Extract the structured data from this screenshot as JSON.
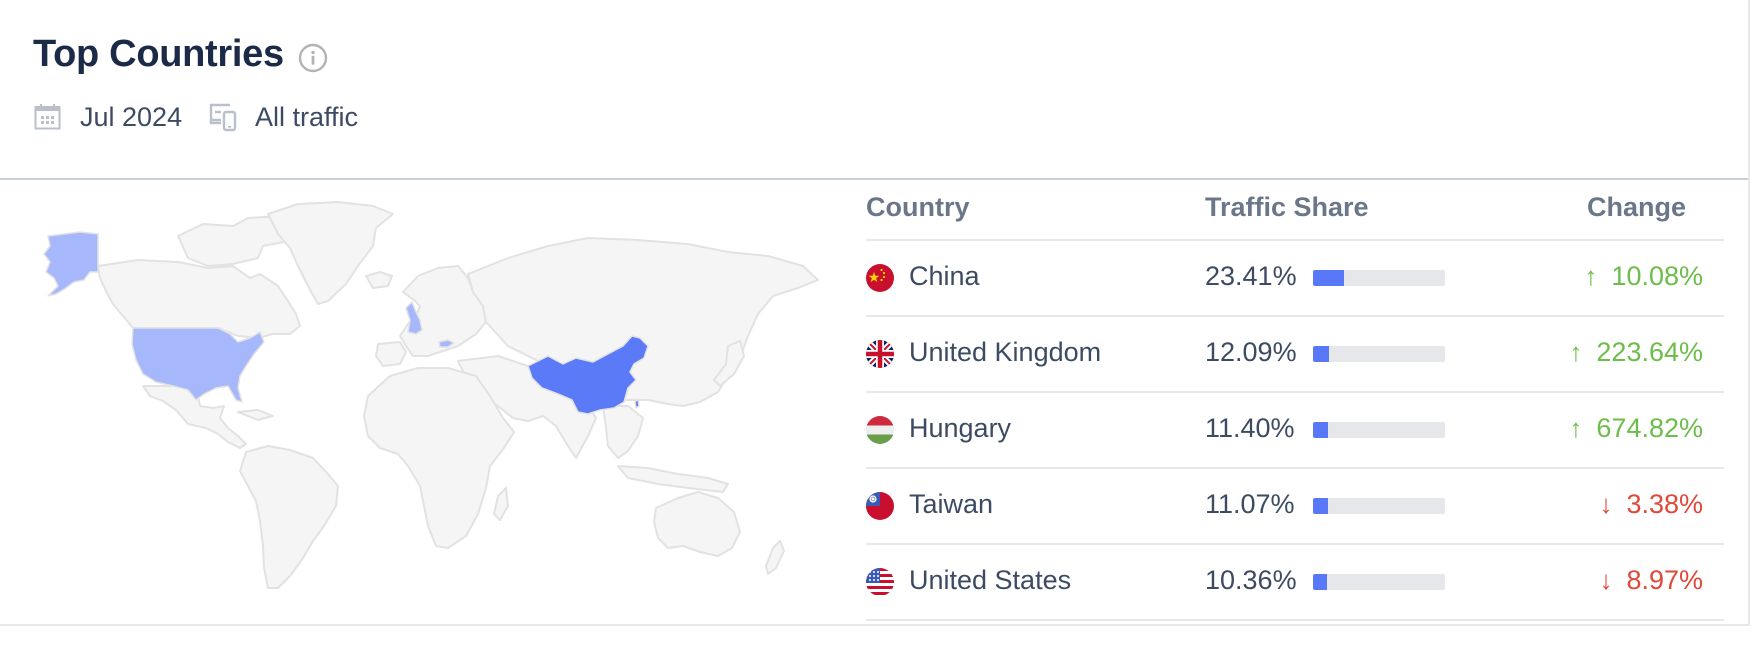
{
  "widget": {
    "title": "Top Countries",
    "info_icon": "info-circle-icon",
    "date_icon": "calendar-icon",
    "date": "Jul 2024",
    "traffic_icon": "devices-icon",
    "traffic_filter": "All traffic"
  },
  "map": {
    "highlight_colors": {
      "strong": "#5a7af8",
      "light": "#a6b8fb",
      "land": "#f5f5f5",
      "border": "#e2e2e2"
    },
    "highlighted_countries": [
      "China",
      "United Kingdom",
      "Hungary",
      "Taiwan",
      "United States"
    ]
  },
  "table": {
    "columns": [
      "Country",
      "Traffic Share",
      "Change"
    ],
    "rows": [
      {
        "country": "China",
        "flag": "flag-china",
        "share": "23.41%",
        "share_value": 23.41,
        "change": "10.08%",
        "direction": "up"
      },
      {
        "country": "United Kingdom",
        "flag": "flag-uk",
        "share": "12.09%",
        "share_value": 12.09,
        "change": "223.64%",
        "direction": "up"
      },
      {
        "country": "Hungary",
        "flag": "flag-hungary",
        "share": "11.40%",
        "share_value": 11.4,
        "change": "674.82%",
        "direction": "up"
      },
      {
        "country": "Taiwan",
        "flag": "flag-taiwan",
        "share": "11.07%",
        "share_value": 11.07,
        "change": "3.38%",
        "direction": "down"
      },
      {
        "country": "United States",
        "flag": "flag-us",
        "share": "10.36%",
        "share_value": 10.36,
        "change": "8.97%",
        "direction": "down"
      }
    ],
    "arrows": {
      "up": "↑",
      "down": "↓"
    },
    "colors": {
      "bar_fill": "#5878f7",
      "bar_track": "#e6e7eb",
      "up": "#6cbd4a",
      "down": "#e0483a"
    }
  }
}
